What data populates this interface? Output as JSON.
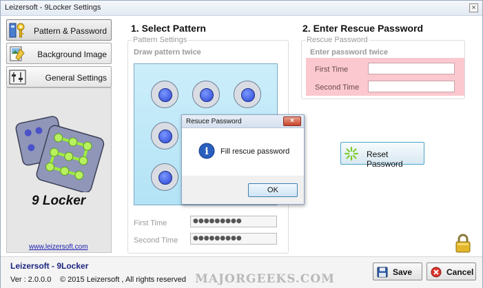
{
  "window": {
    "title": "Leizersoft - 9Locker Settings",
    "close_glyph": "×"
  },
  "sidebar": {
    "items": [
      {
        "label": "Pattern & Password",
        "icon": "key-icon",
        "active": true
      },
      {
        "label": "Background Image",
        "icon": "image-icon",
        "active": false
      },
      {
        "label": "General Settings",
        "icon": "sliders-icon",
        "active": false
      }
    ],
    "app_name": "9 Locker",
    "website": "www.leizersoft.com"
  },
  "pattern_section": {
    "heading": "1. Select Pattern",
    "group_title": "Pattern Settings",
    "instruction": "Draw pattern twice",
    "first_time_label": "First Time",
    "first_time_value": "●●●●●●●●●",
    "second_time_label": "Second Time",
    "second_time_value": "●●●●●●●●●"
  },
  "rescue_section": {
    "heading": "2. Enter Rescue Password",
    "group_title": "Rescue Password",
    "instruction": "Enter password twice",
    "first_time_label": "First Time",
    "first_time_value": "",
    "second_time_label": "Second Time",
    "second_time_value": "",
    "reset_button": "Reset Password"
  },
  "dialog": {
    "title": "Resuce Password",
    "message": "Fill rescue password",
    "ok_button": "OK",
    "close_glyph": "×",
    "info_glyph": "i"
  },
  "footer": {
    "brand": "Leizersoft - 9Locker",
    "version": "Ver :  2.0.0.0",
    "copyright": "© 2015 Leizersoft , All rights reserved",
    "save_button": "Save",
    "cancel_button": "Cancel",
    "watermark": "MAJORGEEKS.COM"
  },
  "colors": {
    "pattern_bg": "#b2e3f6",
    "rescue_bg": "#fbc8cf",
    "brand_text": "#1a237e",
    "link": "#1a1ab0"
  }
}
